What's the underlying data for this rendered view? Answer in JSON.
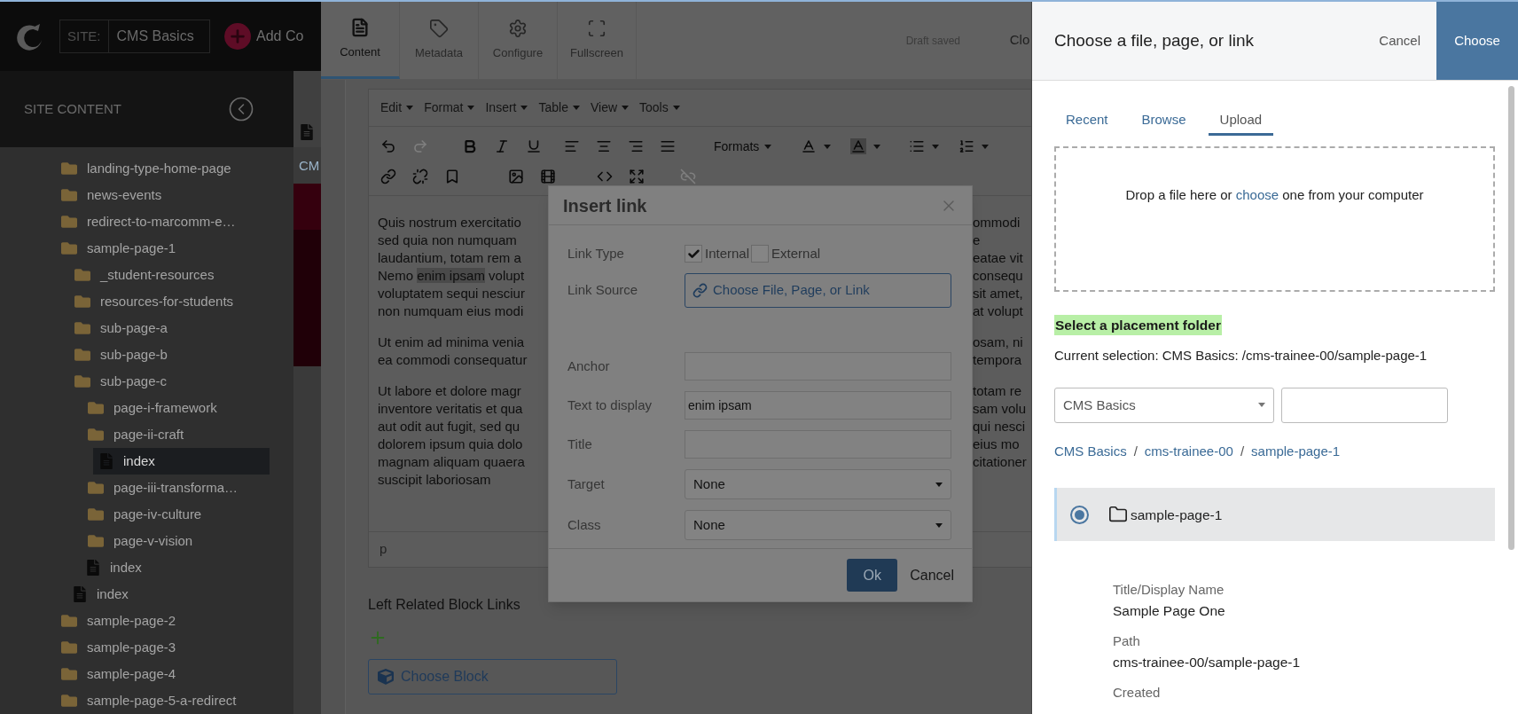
{
  "top_bar": {
    "site_label": "SITE:",
    "site_name": "CMS Basics",
    "add_label": "Add Co"
  },
  "sidebar": {
    "title": "SITE CONTENT",
    "tree": [
      {
        "label": "landing-type-home-page",
        "kind": "folder",
        "selected": false
      },
      {
        "label": "news-events",
        "kind": "folder",
        "selected": false
      },
      {
        "label": "redirect-to-marcomm-e…",
        "kind": "folder",
        "selected": false
      },
      {
        "label": "sample-page-1",
        "kind": "folder",
        "selected": false,
        "children": [
          {
            "label": "_student-resources",
            "kind": "folder",
            "selected": false
          },
          {
            "label": "resources-for-students",
            "kind": "folder",
            "selected": false
          },
          {
            "label": "sub-page-a",
            "kind": "folder",
            "selected": false
          },
          {
            "label": "sub-page-b",
            "kind": "folder",
            "selected": false
          },
          {
            "label": "sub-page-c",
            "kind": "folder",
            "selected": false,
            "children": [
              {
                "label": "page-i-framework",
                "kind": "folder",
                "selected": false
              },
              {
                "label": "page-ii-craft",
                "kind": "folder",
                "selected": false,
                "children": [
                  {
                    "label": "index",
                    "kind": "file",
                    "selected": true
                  }
                ]
              },
              {
                "label": "page-iii-transforma…",
                "kind": "folder",
                "selected": false
              },
              {
                "label": "page-iv-culture",
                "kind": "folder",
                "selected": false
              },
              {
                "label": "page-v-vision",
                "kind": "folder",
                "selected": false
              },
              {
                "label": "index",
                "kind": "file",
                "selected": false
              }
            ]
          },
          {
            "label": "index",
            "kind": "file",
            "selected": false
          }
        ]
      },
      {
        "label": "sample-page-2",
        "kind": "folder",
        "selected": false
      },
      {
        "label": "sample-page-3",
        "kind": "folder",
        "selected": false
      },
      {
        "label": "sample-page-4",
        "kind": "folder",
        "selected": false
      },
      {
        "label": "sample-page-5-a-redirect",
        "kind": "folder",
        "selected": false
      }
    ]
  },
  "background_page": {
    "text": "CM"
  },
  "editor": {
    "tabs": [
      {
        "label": "Content",
        "kind": "content",
        "selected": true
      },
      {
        "label": "Metadata",
        "kind": "metadata",
        "selected": false
      },
      {
        "label": "Configure",
        "kind": "configure",
        "selected": false
      },
      {
        "label": "Fullscreen",
        "kind": "fullscreen",
        "selected": false
      }
    ],
    "status": "Draft saved",
    "close": "Clo",
    "menu": [
      "Edit",
      "Format",
      "Insert",
      "Table",
      "View",
      "Tools"
    ],
    "toolbar_rows": [
      [
        {
          "kind": "undo",
          "disabled": false
        },
        {
          "kind": "redo",
          "disabled": true
        },
        {
          "kind": "bold",
          "disabled": false
        },
        {
          "kind": "italic",
          "disabled": false
        },
        {
          "kind": "underline",
          "disabled": false
        },
        {
          "kind": "align_left",
          "disabled": false
        },
        {
          "kind": "align_center",
          "disabled": false
        },
        {
          "kind": "align_right",
          "disabled": false
        },
        {
          "kind": "justify",
          "disabled": false
        },
        {
          "kind": "formats",
          "label": "Formats",
          "disabled": false
        },
        {
          "kind": "font_color",
          "disabled": false
        },
        {
          "kind": "background_color",
          "disabled": false
        },
        {
          "kind": "bullet_list",
          "disabled": false
        },
        {
          "kind": "numbered_list",
          "disabled": false
        }
      ],
      [
        {
          "kind": "link",
          "disabled": false
        },
        {
          "kind": "unlink",
          "disabled": false
        },
        {
          "kind": "bookmark",
          "disabled": false
        },
        {
          "kind": "image",
          "disabled": false
        },
        {
          "kind": "video",
          "disabled": false
        },
        {
          "kind": "code",
          "disabled": false
        },
        {
          "kind": "expand",
          "disabled": false
        },
        {
          "kind": "chain",
          "disabled": true
        }
      ]
    ],
    "paragraphs": [
      [
        {
          "left": [
            {
              "text": "Quis nostrum exercitatio",
              "highlighted": false
            }
          ],
          "right": "ommodi"
        },
        {
          "left": [
            {
              "text": "sed quia non numquam",
              "highlighted": false
            }
          ],
          "right": "e"
        },
        {
          "left": [
            {
              "text": "laudantium, totam rem a",
              "highlighted": false
            }
          ],
          "right": "eatae vit"
        },
        {
          "left": [
            {
              "text": "Nemo ",
              "highlighted": false
            },
            {
              "text": "enim ipsam",
              "highlighted": true
            },
            {
              "text": " volupt",
              "highlighted": false
            }
          ],
          "right": "consequ"
        },
        {
          "left": [
            {
              "text": "voluptatem sequi nesciur",
              "highlighted": false
            }
          ],
          "right": "sit amet,"
        },
        {
          "left": [
            {
              "text": "non numquam eius modi",
              "highlighted": false
            }
          ],
          "right": "at volupt"
        }
      ],
      [
        {
          "left": [
            {
              "text": "Ut enim ad minima venia",
              "highlighted": false
            }
          ],
          "right": "osam, ni"
        },
        {
          "left": [
            {
              "text": "ea commodi consequatur",
              "highlighted": false
            }
          ],
          "right": "tempora"
        }
      ],
      [
        {
          "left": [
            {
              "text": "Ut labore et dolore magr",
              "highlighted": false
            }
          ],
          "right": "totam re"
        },
        {
          "left": [
            {
              "text": "inventore veritatis et qua",
              "highlighted": false
            }
          ],
          "right": "sam volu"
        },
        {
          "left": [
            {
              "text": "aut odit aut fugit, sed qu",
              "highlighted": false
            }
          ],
          "right": "qui nesci"
        },
        {
          "left": [
            {
              "text": "dolorem ipsum quia dolo",
              "highlighted": false
            }
          ],
          "right": "eius mo"
        },
        {
          "left": [
            {
              "text": "magnam aliquam quaera",
              "highlighted": false
            }
          ],
          "right": "citationer"
        },
        {
          "left": [
            {
              "text": "suscipit laboriosam",
              "highlighted": false
            }
          ]
        }
      ]
    ],
    "path": "p",
    "block_links": {
      "label": "Left Related Block Links",
      "button": "Choose Block"
    }
  },
  "dialog": {
    "title": "Insert link",
    "fields": [
      {
        "kind": "checkboxes",
        "label": "Link Type",
        "options": [
          {
            "label": "Internal",
            "checked": true
          },
          {
            "label": "External",
            "checked": false
          }
        ]
      },
      {
        "kind": "link_button",
        "label": "Link Source",
        "button": "Choose File, Page, or Link"
      },
      {
        "kind": "text",
        "label": "Anchor"
      },
      {
        "kind": "text",
        "label": "Text to display",
        "value": "enim ipsam"
      },
      {
        "kind": "text",
        "label": "Title"
      },
      {
        "kind": "select",
        "label": "Target",
        "value": "None"
      },
      {
        "kind": "select",
        "label": "Class",
        "value": "None"
      }
    ],
    "ok": "Ok",
    "cancel": "Cancel"
  },
  "picker": {
    "title": "Choose a file, page, or link",
    "cancel": "Cancel",
    "choose": "Choose",
    "tabs": [
      {
        "label": "Recent",
        "selected": false
      },
      {
        "label": "Browse",
        "selected": false
      },
      {
        "label": "Upload",
        "selected": true
      }
    ],
    "dropzone": {
      "before": "Drop a file here or ",
      "link": "choose",
      "after": " one from your computer"
    },
    "placement_heading": "Select a placement folder",
    "current_selection": "Current selection: CMS Basics: /cms-trainee-00/sample-page-1",
    "site_select": "CMS Basics",
    "breadcrumbs": [
      {
        "label": "CMS Basics",
        "kind": "link"
      },
      {
        "label": "/",
        "kind": "separator"
      },
      {
        "label": "cms-trainee-00",
        "kind": "link"
      },
      {
        "label": "/",
        "kind": "separator"
      },
      {
        "label": "sample-page-1",
        "kind": "link"
      }
    ],
    "folders": [
      {
        "name": "sample-page-1",
        "selected": true
      }
    ],
    "details": [
      {
        "label": "Title/Display Name",
        "value": "Sample Page One"
      },
      {
        "label": "Path",
        "value": "cms-trainee-00/sample-page-1"
      },
      {
        "label": "Created"
      }
    ]
  }
}
